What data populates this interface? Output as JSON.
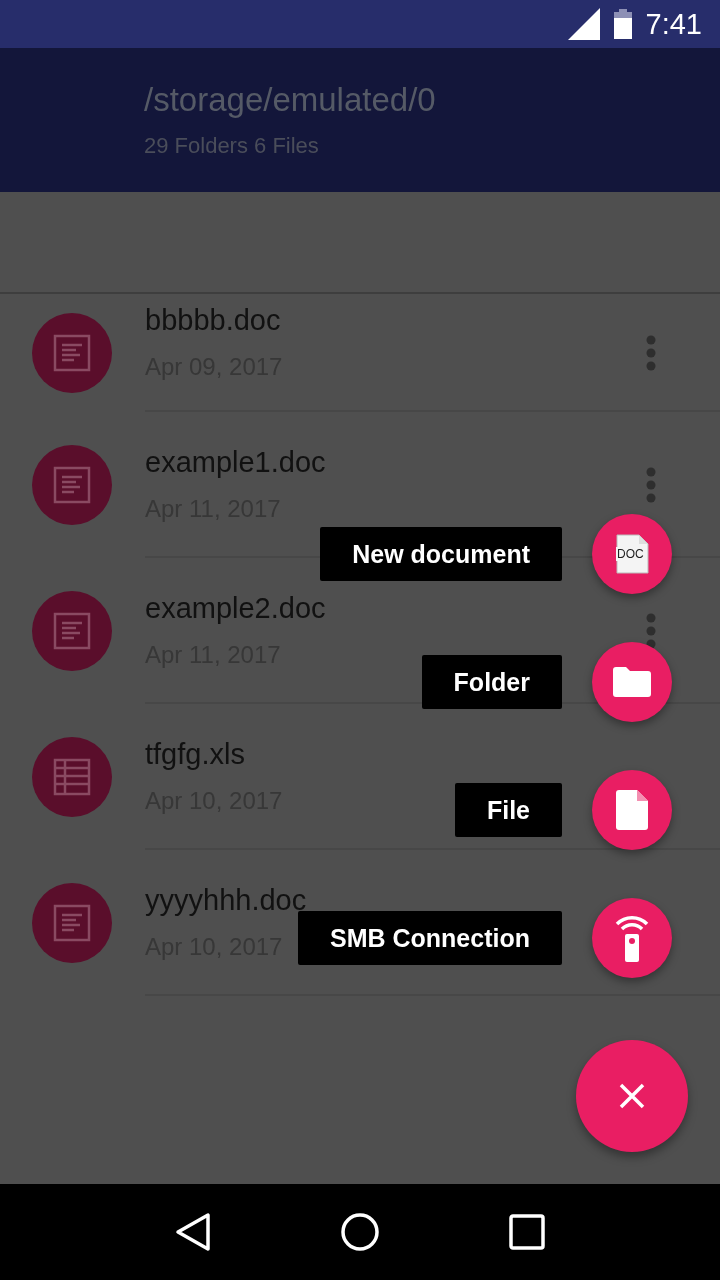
{
  "status_bar": {
    "time": "7:41"
  },
  "app_bar": {
    "title": "/storage/emulated/0",
    "subtitle": "29 Folders 6 Files"
  },
  "files": [
    {
      "name": "bbbbb.doc",
      "date": "Apr 09, 2017",
      "kind": "doc",
      "has_menu": true
    },
    {
      "name": "example1.doc",
      "date": "Apr 11, 2017",
      "kind": "doc",
      "has_menu": true
    },
    {
      "name": "example2.doc",
      "date": "Apr 11, 2017",
      "kind": "doc",
      "has_menu": true
    },
    {
      "name": "tfgfg.xls",
      "date": "Apr 10, 2017",
      "kind": "sheet",
      "has_menu": false
    },
    {
      "name": "yyyyhhh.doc",
      "date": "Apr 10, 2017",
      "kind": "doc",
      "has_menu": false
    }
  ],
  "fab_menu": {
    "expanded": true,
    "items": [
      {
        "label": "New document",
        "kind": "doc",
        "icon_text": "DOC"
      },
      {
        "label": "Folder",
        "kind": "folder"
      },
      {
        "label": "File",
        "kind": "file"
      },
      {
        "label": "SMB Connection",
        "kind": "smb"
      }
    ]
  }
}
